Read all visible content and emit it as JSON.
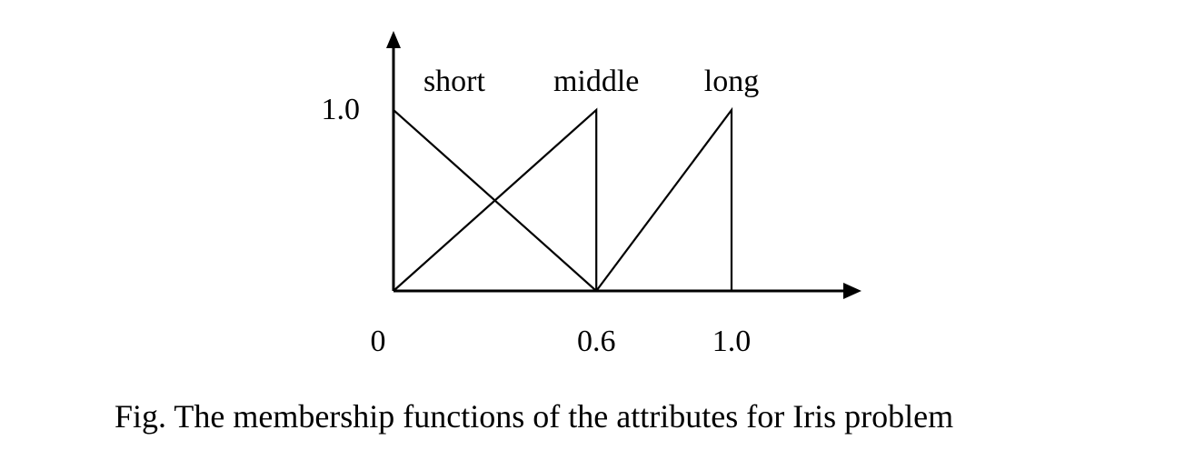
{
  "caption": "Fig. The membership functions of the attributes for Iris problem",
  "chart_data": {
    "type": "line",
    "title": "",
    "xlabel": "",
    "ylabel": "",
    "xlim": [
      0,
      1.0
    ],
    "ylim": [
      0,
      1.0
    ],
    "grid": false,
    "axis_arrows": true,
    "x_ticks": [
      {
        "value": 0,
        "label": "0"
      },
      {
        "value": 0.6,
        "label": "0.6"
      },
      {
        "value": 1.0,
        "label": "1.0"
      }
    ],
    "y_ticks": [
      {
        "value": 1.0,
        "label": "1.0"
      }
    ],
    "series": [
      {
        "name": "short",
        "x": [
          0,
          0.6
        ],
        "y": [
          1.0,
          0
        ]
      },
      {
        "name": "middle",
        "x": [
          0,
          0.6,
          0.6,
          1.0
        ],
        "y": [
          0,
          1.0,
          0,
          0
        ]
      },
      {
        "name": "long",
        "x": [
          0.6,
          1.0,
          1.0
        ],
        "y": [
          0,
          1.0,
          0
        ]
      }
    ],
    "series_label_anchor_x": [
      0.18,
      0.6,
      1.0
    ]
  }
}
